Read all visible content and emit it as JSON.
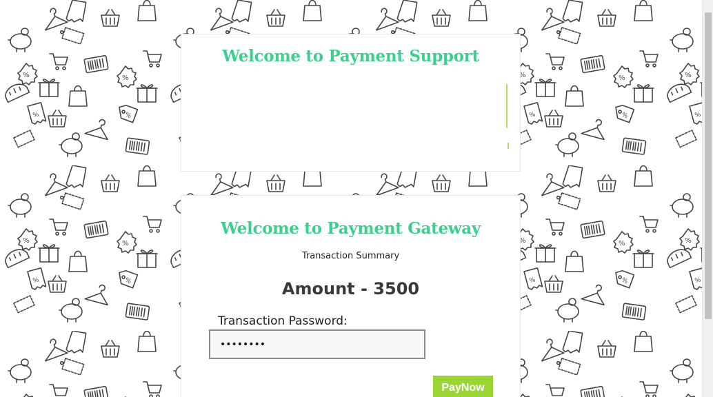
{
  "support": {
    "title": "Welcome to Payment Support"
  },
  "gateway": {
    "title": "Welcome to Payment Gateway",
    "summary": "Transaction Summary",
    "amount": "Amount - 3500",
    "password_label": "Transaction Password:",
    "password_value": "passw0rd",
    "pay_button": "PayNow"
  },
  "colors": {
    "accent_title": "#3ecf8e",
    "button": "#9bd534",
    "pattern_stroke": "#444444"
  },
  "background": {
    "pattern_icons": [
      "piggy-bank-icon",
      "shopping-basket-icon",
      "price-tag-icon",
      "percent-badge-icon",
      "shopping-cart-icon",
      "hanger-icon",
      "barcode-icon",
      "gift-box-icon",
      "shopping-bag-icon",
      "wallet-icon",
      "receipt-icon",
      "coupon-icon"
    ]
  }
}
